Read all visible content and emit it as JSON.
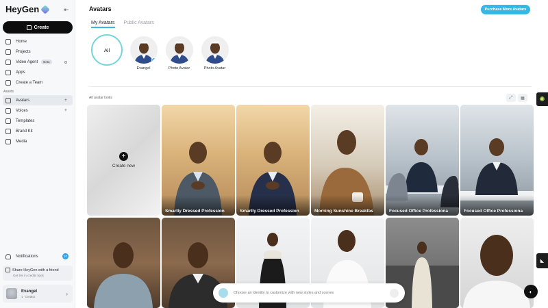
{
  "app": {
    "name": "HeyGen"
  },
  "sidebar": {
    "create_label": "Create",
    "items": [
      {
        "label": "Home",
        "icon": "home-icon"
      },
      {
        "label": "Projects",
        "icon": "projects-icon"
      },
      {
        "label": "Video Agent",
        "icon": "video-agent-icon",
        "badge": "Beta"
      },
      {
        "label": "Apps",
        "icon": "apps-icon"
      },
      {
        "label": "Create a Team",
        "icon": "team-icon"
      }
    ],
    "assets_label": "Assets",
    "asset_items": [
      {
        "label": "Avatars",
        "icon": "avatar-icon",
        "active": true
      },
      {
        "label": "Voices",
        "icon": "voice-icon"
      },
      {
        "label": "Templates",
        "icon": "template-icon"
      },
      {
        "label": "Brand Kit",
        "icon": "brand-kit-icon"
      },
      {
        "label": "Media",
        "icon": "media-icon"
      }
    ],
    "notifications": {
      "label": "Notifications",
      "count": "10"
    },
    "share": {
      "title": "Share HeyGen with a friend",
      "subtitle": "Get 5% in credits back"
    },
    "user": {
      "name": "Evangel",
      "count": "1",
      "role": "Creator"
    }
  },
  "main": {
    "title": "Avatars",
    "purchase_label": "Purchase More Avatars",
    "tabs": [
      {
        "label": "My Avatars",
        "active": true
      },
      {
        "label": "Public Avatars",
        "active": false
      }
    ],
    "all_label": "All",
    "avatars": [
      {
        "label": "Evangel",
        "selected": true
      },
      {
        "label": "Photo Avatar",
        "selected": false
      },
      {
        "label": "Photo Avatar",
        "selected": false
      }
    ],
    "looks_label": "All avatar looks",
    "create_new_label": "Create new",
    "looks": [
      {
        "caption": "Smartly Dressed Profession",
        "scene": "warm"
      },
      {
        "caption": "Smartly Dressed Profession",
        "scene": "warm"
      },
      {
        "caption": "Morning Sunshine Breakfas",
        "scene": "cafe"
      },
      {
        "caption": "Focused Office Professiona",
        "scene": "office"
      },
      {
        "caption": "Focused Office Professiona",
        "scene": "office"
      },
      {
        "caption": "",
        "scene": "rest"
      },
      {
        "caption": "",
        "scene": "rest"
      },
      {
        "caption": "",
        "scene": "white"
      },
      {
        "caption": "",
        "scene": "white"
      },
      {
        "caption": "",
        "scene": "event"
      },
      {
        "caption": "",
        "scene": "light"
      }
    ],
    "prompt_placeholder": "Choose an identity to customize with new styles and scenes"
  },
  "colors": {
    "accent": "#36b8e4",
    "primary_button": "#0d0d0d",
    "sidebar_bg": "#f7f8fa"
  }
}
